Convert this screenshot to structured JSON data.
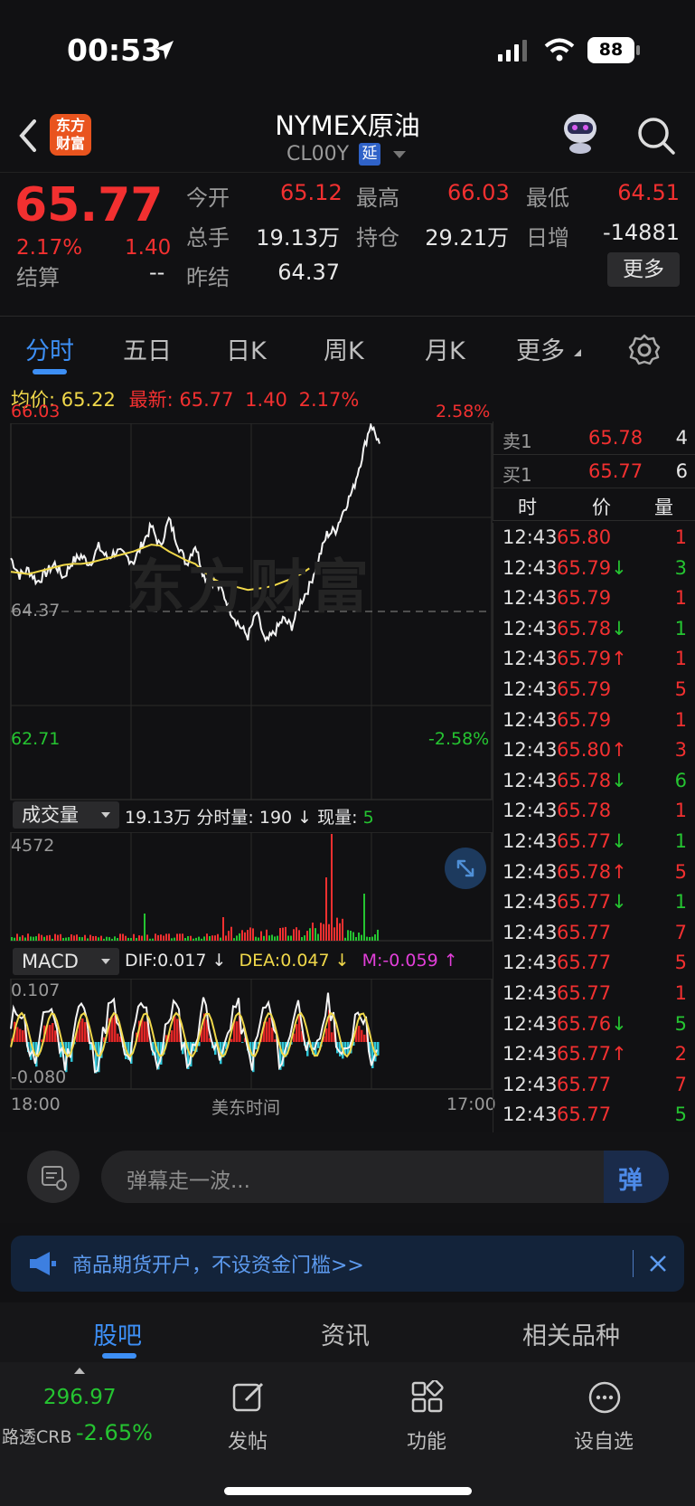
{
  "status_bar": {
    "time": "00:53",
    "battery": "88"
  },
  "header": {
    "title": "NYMEX原油",
    "symbol": "CL00Y",
    "delay_badge": "延",
    "logo_text": "东方财富"
  },
  "quote": {
    "price": "65.77",
    "change_pct": "2.17%",
    "change": "1.40",
    "open_label": "今开",
    "open": "65.12",
    "high_label": "最高",
    "high": "66.03",
    "low_label": "最低",
    "low": "64.51",
    "volume_label": "总手",
    "volume": "19.13万",
    "oi_label": "持仓",
    "oi": "29.21万",
    "daily_inc_label": "日增",
    "daily_inc": "-14881",
    "settle_label": "结算",
    "settle": "--",
    "prev_settle_label": "昨结",
    "prev_settle": "64.37",
    "more_button": "更多"
  },
  "tabs": [
    {
      "label": "分时",
      "active": true
    },
    {
      "label": "五日"
    },
    {
      "label": "日K"
    },
    {
      "label": "周K"
    },
    {
      "label": "月K"
    },
    {
      "label": "更多"
    }
  ],
  "chart": {
    "avg_label": "均价:",
    "avg_value": "65.22",
    "latest_label": "最新:",
    "latest_value": "65.77",
    "latest_change": "1.40",
    "latest_pct": "2.17%",
    "y_top": "66.03",
    "y_mid": "64.37",
    "y_bottom": "62.71",
    "pct_top": "2.58%",
    "pct_bottom": "-2.58%",
    "watermark": "东方财富",
    "volume_selector": "成交量",
    "volume_info": "19.13万 分时量: 190 ↓ 现量:",
    "volume_now": "5",
    "volume_max": "4572",
    "macd_selector": "MACD",
    "dif": "DIF:0.017 ↓",
    "dea": "DEA:0.047 ↓",
    "m": "M:-0.059 ↑",
    "macd_top": "0.107",
    "macd_bottom": "-0.080",
    "x_start": "18:00",
    "x_mid": "美东时间",
    "x_end": "17:00"
  },
  "chart_data": {
    "type": "line",
    "series": [
      {
        "values": [
          64.84,
          64.69,
          64.74,
          64.63,
          64.71,
          64.79,
          64.67,
          64.81,
          64.86,
          64.79,
          64.94,
          64.84,
          64.9,
          64.86,
          64.81,
          64.97,
          65.12,
          64.94,
          65.18,
          64.97,
          64.79,
          64.96,
          64.68,
          64.64,
          64.56,
          64.38,
          64.25,
          64.15,
          64.36,
          64.09,
          64.18,
          64.3,
          64.24,
          64.45,
          64.59,
          64.82,
          65.05,
          65.09,
          65.28,
          65.45,
          65.74,
          66.03,
          65.85
        ]
      },
      {
        "values": [
          64.72,
          64.71,
          64.7,
          64.72,
          64.74,
          64.76,
          64.78,
          64.79,
          64.79,
          64.8,
          64.82,
          64.84,
          64.86,
          64.88,
          64.9,
          64.93,
          64.96,
          64.95,
          64.9,
          64.86,
          64.82,
          64.79,
          64.72,
          64.66,
          64.62,
          64.6,
          64.58,
          64.56,
          64.57,
          64.58,
          64.6,
          64.63,
          64.66,
          64.7,
          64.75
        ]
      }
    ],
    "ylim": [
      62.71,
      66.03
    ]
  },
  "order_book": {
    "sell_label": "卖1",
    "sell_price": "65.78",
    "sell_qty": "4",
    "buy_label": "买1",
    "buy_price": "65.77",
    "buy_qty": "6",
    "col_time": "时",
    "col_price": "价",
    "col_qty": "量"
  },
  "ticks": [
    {
      "time": "12:43",
      "price": "65.80",
      "arrow": "",
      "qty": "1",
      "qc": "red"
    },
    {
      "time": "12:43",
      "price": "65.79",
      "arrow": "↓",
      "qty": "3",
      "qc": "green"
    },
    {
      "time": "12:43",
      "price": "65.79",
      "arrow": "",
      "qty": "1",
      "qc": "red"
    },
    {
      "time": "12:43",
      "price": "65.78",
      "arrow": "↓",
      "qty": "1",
      "qc": "green"
    },
    {
      "time": "12:43",
      "price": "65.79",
      "arrow": "↑",
      "qty": "1",
      "qc": "red"
    },
    {
      "time": "12:43",
      "price": "65.79",
      "arrow": "",
      "qty": "5",
      "qc": "red"
    },
    {
      "time": "12:43",
      "price": "65.79",
      "arrow": "",
      "qty": "1",
      "qc": "red"
    },
    {
      "time": "12:43",
      "price": "65.80",
      "arrow": "↑",
      "qty": "3",
      "qc": "red"
    },
    {
      "time": "12:43",
      "price": "65.78",
      "arrow": "↓",
      "qty": "6",
      "qc": "green"
    },
    {
      "time": "12:43",
      "price": "65.78",
      "arrow": "",
      "qty": "1",
      "qc": "red"
    },
    {
      "time": "12:43",
      "price": "65.77",
      "arrow": "↓",
      "qty": "1",
      "qc": "green"
    },
    {
      "time": "12:43",
      "price": "65.78",
      "arrow": "↑",
      "qty": "5",
      "qc": "red"
    },
    {
      "time": "12:43",
      "price": "65.77",
      "arrow": "↓",
      "qty": "1",
      "qc": "green"
    },
    {
      "time": "12:43",
      "price": "65.77",
      "arrow": "",
      "qty": "7",
      "qc": "red"
    },
    {
      "time": "12:43",
      "price": "65.77",
      "arrow": "",
      "qty": "5",
      "qc": "red"
    },
    {
      "time": "12:43",
      "price": "65.77",
      "arrow": "",
      "qty": "1",
      "qc": "red"
    },
    {
      "time": "12:43",
      "price": "65.76",
      "arrow": "↓",
      "qty": "5",
      "qc": "green"
    },
    {
      "time": "12:43",
      "price": "65.77",
      "arrow": "↑",
      "qty": "2",
      "qc": "red"
    },
    {
      "time": "12:43",
      "price": "65.77",
      "arrow": "",
      "qty": "7",
      "qc": "red"
    },
    {
      "time": "12:43",
      "price": "65.77",
      "arrow": "",
      "qty": "5",
      "qc": "green"
    }
  ],
  "danmu": {
    "placeholder": "弹幕走一波...",
    "send_icon_text": "弹"
  },
  "banner": {
    "text": "商品期货开户，不设资金门槛>>"
  },
  "subtabs": [
    {
      "label": "股吧",
      "active": true
    },
    {
      "label": "资讯"
    },
    {
      "label": "相关品种"
    }
  ],
  "bottom": {
    "index_value": "296.97",
    "index_name": "路透CRB",
    "index_pct": "-2.65%",
    "post_label": "发帖",
    "func_label": "功能",
    "watch_label": "设自选"
  },
  "colors": {
    "up": "#f23030",
    "down": "#25c431",
    "avg_line": "#f0d84a",
    "accent": "#3d8ff5"
  }
}
